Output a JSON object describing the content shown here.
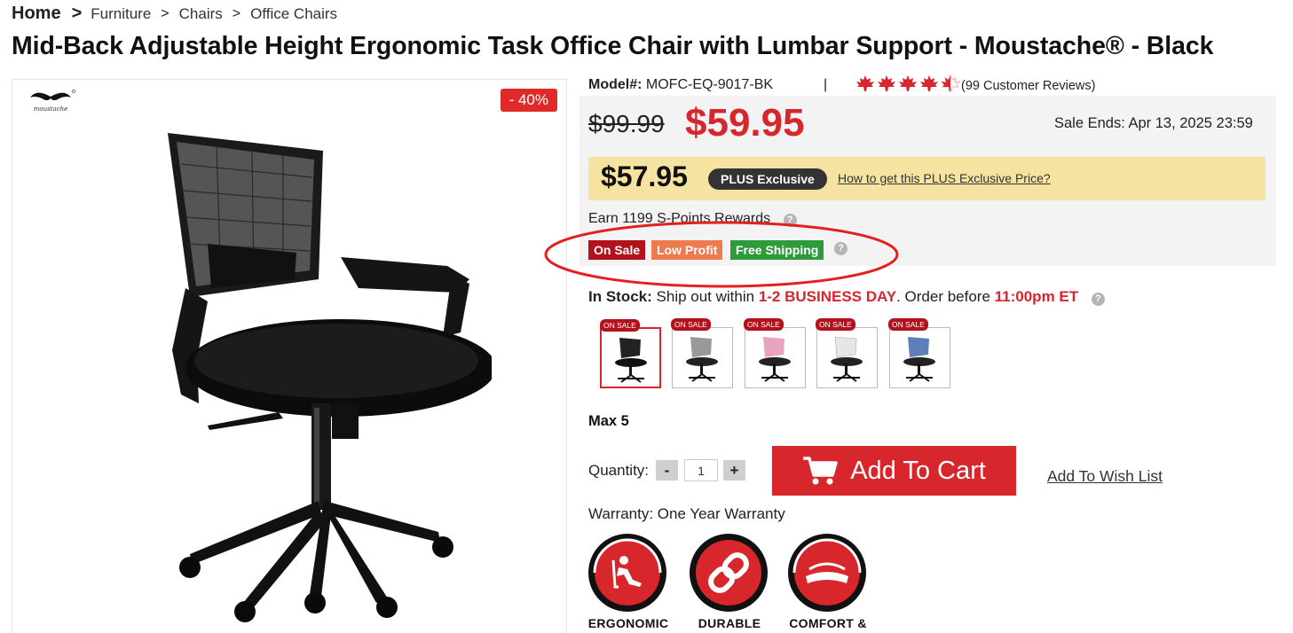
{
  "breadcrumb": {
    "home": "Home",
    "sep": ">",
    "items": [
      "Furniture",
      "Chairs",
      "Office Chairs"
    ]
  },
  "product": {
    "title": "Mid-Back Adjustable Height Ergonomic Task Office Chair with Lumbar Support - Moustache® - Black",
    "model_label": "Model#:",
    "model_value": "MOFC-EQ-9017-BK",
    "rating_stars": 4.5,
    "reviews_text": "(99 Customer Reviews)",
    "discount_badge": "- 40%",
    "old_price": "$99.99",
    "price": "$59.95",
    "sale_ends": "Sale Ends: Apr 13, 2025 23:59",
    "plus_price": "$57.95",
    "plus_pill": "PLUS Exclusive",
    "plus_link": "How to get this PLUS Exclusive Price?",
    "points_text": "Earn 1199 S-Points Rewards",
    "tags": [
      "On Sale",
      "Low Profit",
      "Free Shipping"
    ],
    "stock": {
      "label": "In Stock:",
      "text1": " Ship out within ",
      "days": "1-2 BUSINESS DAY",
      "text2": ". Order before ",
      "time": "11:00pm ET"
    },
    "swatch_label": "ON SALE",
    "swatches": [
      "black",
      "gray",
      "pink",
      "white",
      "blue"
    ],
    "max_text": "Max 5",
    "quantity_label": "Quantity:",
    "quantity_value": "1",
    "minus": "-",
    "plus": "+",
    "add_to_cart": "Add To Cart",
    "wish_list": "Add To Wish List",
    "warranty": "Warranty: One Year Warranty",
    "badges": [
      "ERGONOMIC",
      "DURABLE",
      "COMFORT &"
    ]
  },
  "colors": {
    "accent_red": "#d7262c",
    "plus_bg": "#f7e3a1",
    "tag_on_sale": "#b3121c",
    "tag_low_profit": "#ef7a4f",
    "tag_free_shipping": "#2e9b3a"
  }
}
